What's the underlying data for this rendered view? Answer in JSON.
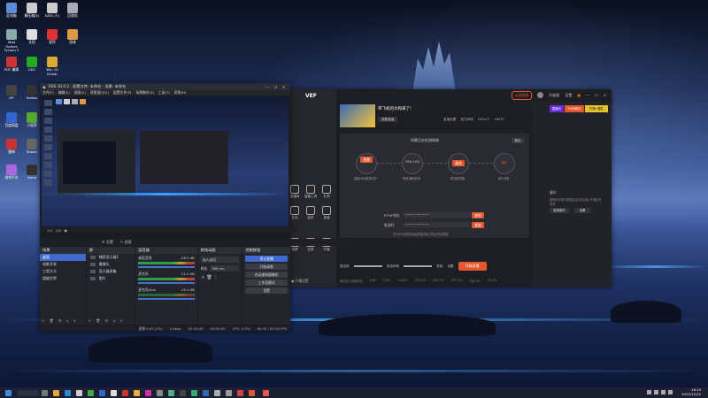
{
  "colors": {
    "accent": "#3f6bd1",
    "orange": "#e4572e",
    "obs_bg": "#1b1c22",
    "app_bg": "#1d1e23"
  },
  "desktop": {
    "icons": [
      {
        "name": "此电脑",
        "color": "#5b8ed6"
      },
      {
        "name": "解压缩(E)",
        "color": "#ccc"
      },
      {
        "name": "SATA (F:)",
        "color": "#ccc"
      },
      {
        "name": "回收站",
        "color": "#aab"
      },
      {
        "name": "Mad Games Tycoon 2",
        "color": "#8aa"
      },
      {
        "name": "文档",
        "color": "#ddd"
      },
      {
        "name": "程序",
        "color": "#d33"
      },
      {
        "name": "游戏",
        "color": "#d94"
      },
      {
        "name": "PDF 编辑",
        "color": "#c33"
      },
      {
        "name": "GDC",
        "color": "#2a2"
      },
      {
        "name": "Win 10 Driver",
        "color": "#da3"
      },
      {
        "name": "HP",
        "color": "#444"
      },
      {
        "name": "Hollow",
        "color": "#333"
      },
      {
        "name": "百度网盘",
        "color": "#36c"
      },
      {
        "name": "小程序",
        "color": "#5a3"
      },
      {
        "name": "雷神",
        "color": "#c33"
      },
      {
        "name": "Steam",
        "color": "#666"
      },
      {
        "name": "游戏平台",
        "color": "#a6d"
      },
      {
        "name": "Arma",
        "color": "#333"
      }
    ]
  },
  "obs": {
    "title": "OBS 30.0.2 - 配置文件: 未命名 - 场景: 未命名",
    "menu": [
      "文件(F)",
      "编辑(E)",
      "视图(V)",
      "停靠窗口(D)",
      "配置文件(P)",
      "场景集合(S)",
      "工具(T)",
      "帮助(H)"
    ],
    "preview_status": "1/4 · 2/8 · ●",
    "tabs": {
      "scenes_tab": "⚙ 设置",
      "sources_tab": "✂ 滤镜"
    },
    "scenes_label": "未选择源",
    "docks": {
      "scenes": {
        "title": "场景",
        "items": [
          "桌面",
          "电影开发",
          "工程大卡",
          "超级世界"
        ]
      },
      "sources": {
        "title": "源",
        "items": [
          "捕获显示器1",
          "摄像头",
          "显示器采集",
          "图片"
        ]
      },
      "mixer": {
        "title": "混音器",
        "channels": [
          {
            "name": "桌面音频",
            "value": "-26.0 dB"
          },
          {
            "name": "麦克风",
            "value": "-21.0 dB"
          },
          {
            "name": "麦克风/Aux",
            "value": "-15.0 dB"
          }
        ]
      },
      "transitions": {
        "title": "转场动画",
        "type": "淡入淡出",
        "duration_label": "时长",
        "duration": "300 ms"
      },
      "controls": {
        "title": "控制按钮",
        "buttons": [
          "停止直播",
          "开始录制",
          "启动虚拟摄像机",
          "工作室模式",
          "设置"
        ]
      }
    },
    "status": [
      "直播 0:00 (0%)",
      "0 kbps",
      "00:00:00",
      "00:00:00",
      "CPU: 0.5%",
      "60.00 / 60.00 FPS"
    ]
  },
  "app": {
    "logo": "VEF",
    "top_right": [
      "公测系统",
      "升级版",
      "设置"
    ],
    "stream_title": "带飞机的大和来了!",
    "stream_meta": [
      "直播设置",
      "官方声明",
      "243477",
      "18097"
    ],
    "tag": "准备就绪",
    "status_label": "所需正在检测网络",
    "chip": "退出",
    "flow": [
      {
        "label": "直播",
        "sub": "直播OBS推流同步"
      },
      {
        "label": "70% 12%",
        "sub": "带宽.编码检测"
      },
      {
        "label": "推流",
        "sub": "推流服务器"
      },
      {
        "label": "观众",
        "sub": "观众列表"
      }
    ],
    "rtmp_label": "RTMP地址",
    "rtmp_value": "••••••••••••",
    "key_label": "推流码",
    "key_value": "••••••••••••",
    "copy_btn": "复制",
    "hint": "在OBS中粘贴地址和推流码,然后开始直播",
    "bottom_controls": [
      "麦克风",
      "系统声音",
      "录制",
      "设置"
    ],
    "start_button": "开始直播",
    "footer": [
      "继续显示直播状态",
      "5/80",
      "SYNC",
      "1%/5%",
      "CPU 0%",
      "GPU 7%",
      "CPU 2%",
      "内存 4%",
      "5H 5%"
    ],
    "left_menu": [
      "直播间",
      "直播工具",
      "礼物",
      "互动",
      "装扮",
      "直播",
      "投票",
      "连麦",
      "开播",
      "弹幕",
      "更多"
    ],
    "left_footer": "● 开播设置",
    "right_panel": {
      "title": "观众",
      "text": "直播间中观众数据会显示在此处,开播后可查看",
      "btn1": "邀请观众",
      "btn2": "设置"
    },
    "right_badges": [
      {
        "text": "直播中",
        "color": "#6b2bd9"
      },
      {
        "text": "7000积分",
        "color": "#e4572e"
      },
      {
        "text": "开通+赠礼",
        "color": "#e6c42a"
      }
    ]
  },
  "taskbar": {
    "time": "18:15",
    "date": "2025/12/12"
  }
}
